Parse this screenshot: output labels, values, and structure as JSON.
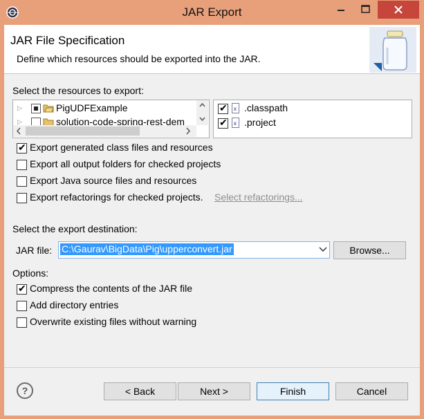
{
  "window": {
    "title": "JAR Export"
  },
  "header": {
    "title": "JAR File Specification",
    "description": "Define which resources should be exported into the JAR."
  },
  "resources": {
    "label": "Select the resources to export:",
    "tree_items": [
      {
        "label": "PigUDFExample",
        "checked": "partial"
      },
      {
        "label": "solution-code-spring-rest-dem",
        "checked": "none"
      }
    ],
    "file_items": [
      {
        "label": ".classpath",
        "checked": true
      },
      {
        "label": ".project",
        "checked": true
      }
    ]
  },
  "export_options": [
    {
      "label": "Export generated class files and resources",
      "checked": true
    },
    {
      "label": "Export all output folders for checked projects",
      "checked": false
    },
    {
      "label": "Export Java source files and resources",
      "checked": false
    },
    {
      "label": "Export refactorings for checked projects.",
      "checked": false
    }
  ],
  "select_refactorings_link": "Select refactorings...",
  "destination": {
    "label": "Select the export destination:",
    "jar_file_label": "JAR file:",
    "jar_file_value": "C:\\Gaurav\\BigData\\Pig\\upperconvert.jar",
    "browse_label": "Browse..."
  },
  "options": {
    "label": "Options:",
    "items": [
      {
        "label": "Compress the contents of the JAR file",
        "checked": true
      },
      {
        "label": "Add directory entries",
        "checked": false
      },
      {
        "label": "Overwrite existing files without warning",
        "checked": false
      }
    ]
  },
  "buttons": {
    "help": "?",
    "back": "< Back",
    "next": "Next >",
    "finish": "Finish",
    "cancel": "Cancel"
  },
  "colors": {
    "titlebar": "#e8a07a",
    "close_button": "#c7463c",
    "selection": "#3399ff",
    "dialog_bg": "#f0f0f0"
  }
}
